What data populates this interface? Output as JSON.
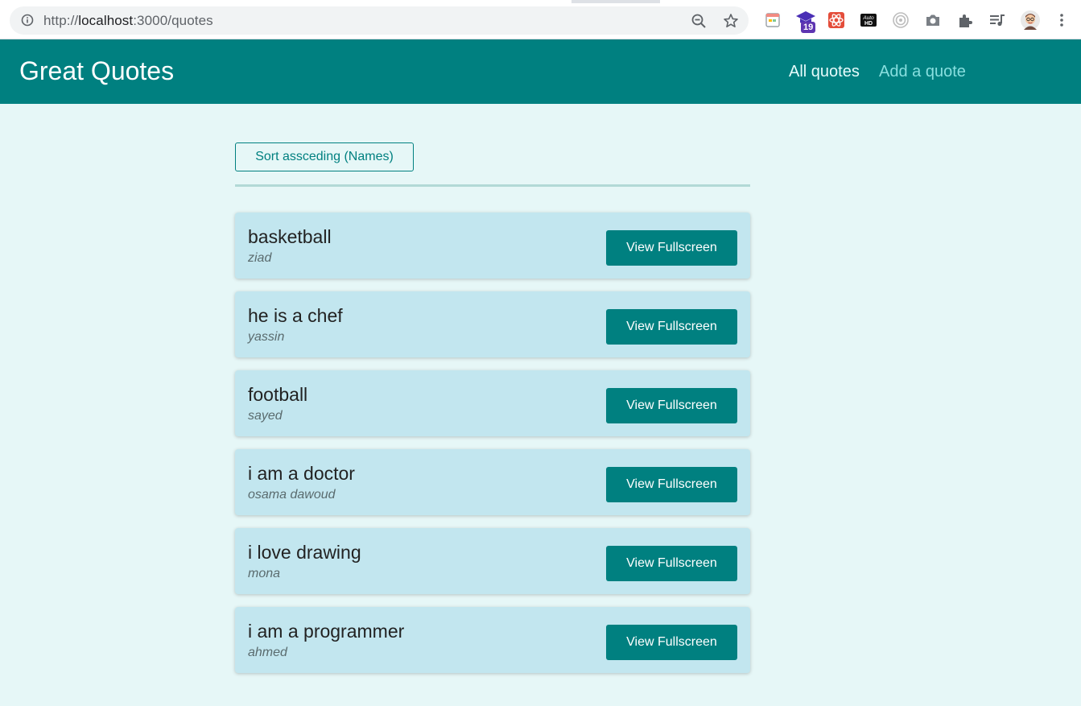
{
  "browser": {
    "url_prefix": "http://",
    "url_host": "localhost",
    "url_path": ":3000/quotes",
    "extension_badge": "19",
    "extension_autohd": "Auto HD"
  },
  "header": {
    "title": "Great Quotes",
    "nav": [
      {
        "label": "All quotes",
        "active": true
      },
      {
        "label": "Add a quote",
        "active": false
      }
    ]
  },
  "main": {
    "sort_label": "Sort assceding (Names)",
    "quotes": [
      {
        "text": "basketball",
        "author": "ziad",
        "button": "View Fullscreen"
      },
      {
        "text": "he is a chef",
        "author": "yassin",
        "button": "View Fullscreen"
      },
      {
        "text": "football",
        "author": "sayed",
        "button": "View Fullscreen"
      },
      {
        "text": "i am a doctor",
        "author": "osama dawoud",
        "button": "View Fullscreen"
      },
      {
        "text": "i love drawing",
        "author": "mona",
        "button": "View Fullscreen"
      },
      {
        "text": "i am a programmer",
        "author": "ahmed",
        "button": "View Fullscreen"
      }
    ]
  },
  "colors": {
    "primary": "#008080",
    "page_bg": "#e6f7f7",
    "card_bg": "#c2e6ef"
  }
}
